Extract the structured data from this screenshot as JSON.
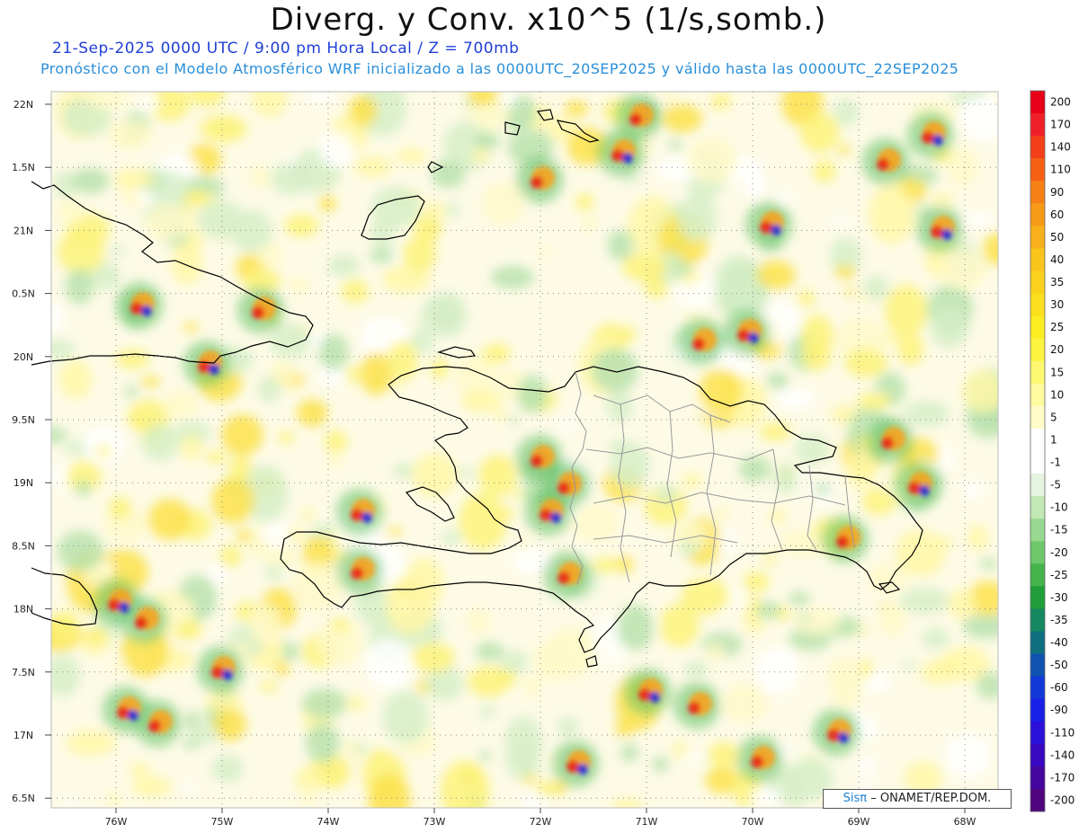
{
  "header": {
    "title": "Diverg. y Conv. x10^5 (1/s,somb.)",
    "date_line": "21-Sep-2025  0000 UTC / 9:00 pm Hora Local / Z = 700mb",
    "model_line": "Pronóstico con el Modelo Atmosférico WRF inicializado a las 0000UTC_20SEP2025 y válido hasta las  0000UTC_22SEP2025"
  },
  "map": {
    "lat_labels": [
      "22N",
      "1.5N",
      "21N",
      "0.5N",
      "20N",
      "9.5N",
      "19N",
      "8.5N",
      "18N",
      "7.5N",
      "17N",
      "6.5N"
    ],
    "lon_labels": [
      "76W",
      "75W",
      "74W",
      "73W",
      "72W",
      "71W",
      "70W",
      "69W",
      "68W"
    ],
    "region": "Hispaniola / Caribbean"
  },
  "colorbar": {
    "labels": [
      "200",
      "170",
      "140",
      "110",
      "90",
      "60",
      "50",
      "40",
      "35",
      "30",
      "25",
      "20",
      "15",
      "10",
      "5",
      "1",
      "-1",
      "-5",
      "-10",
      "-15",
      "-20",
      "-25",
      "-30",
      "-35",
      "-40",
      "-50",
      "-60",
      "-90",
      "-110",
      "-140",
      "-170",
      "-200"
    ],
    "colors": [
      "#e8001a",
      "#f0202a",
      "#f4401a",
      "#f56014",
      "#f68016",
      "#f79a18",
      "#f8b01a",
      "#f9c41c",
      "#fad21c",
      "#fbe01e",
      "#fcec22",
      "#fdf440",
      "#fdf870",
      "#fefaa0",
      "#fffcc8",
      "#ffffff",
      "#ffffff",
      "#e4f4de",
      "#c2e8b6",
      "#98d890",
      "#6cc86a",
      "#44b44a",
      "#1f9e3a",
      "#148860",
      "#0f6e80",
      "#1052b0",
      "#1238d8",
      "#1820e8",
      "#2a10d8",
      "#3a08c0",
      "#44069e",
      "#50047e"
    ]
  },
  "credit": {
    "brand": "Sisπ",
    "text": "– ONAMET/REP.DOM."
  }
}
